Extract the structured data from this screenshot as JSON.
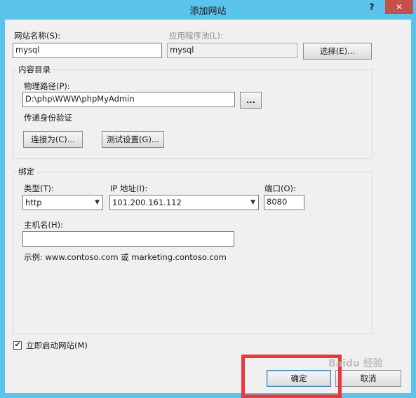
{
  "window": {
    "title": "添加网站",
    "help_label": "?",
    "close_label": "✕"
  },
  "site": {
    "name_label": "网站名称(S):",
    "name_value": "mysql",
    "pool_label": "应用程序池(L):",
    "pool_value": "mysql",
    "select_button": "选择(E)..."
  },
  "content": {
    "group_title": "内容目录",
    "path_label": "物理路径(P):",
    "path_value": "D:\\php\\WWW\\phpMyAdmin",
    "browse_button": "...",
    "auth_label": "传递身份验证",
    "connect_as_button": "连接为(C)...",
    "test_settings_button": "测试设置(G)..."
  },
  "binding": {
    "group_title": "绑定",
    "type_label": "类型(T):",
    "type_value": "http",
    "ip_label": "IP 地址(I):",
    "ip_value": "101.200.161.112",
    "port_label": "端口(O):",
    "port_value": "8080",
    "host_label": "主机名(H):",
    "host_value": "",
    "example_text": "示例: www.contoso.com 或 marketing.contoso.com"
  },
  "start": {
    "checked": true,
    "check_mark": "✔",
    "label": "立即启动网站(M)"
  },
  "footer": {
    "ok_button": "确定",
    "cancel_button": "取消"
  },
  "colors": {
    "titlebar": "#5bc4ec",
    "close": "#c7504a",
    "highlight": "#e8383b"
  },
  "watermark": "Baidu 经验"
}
